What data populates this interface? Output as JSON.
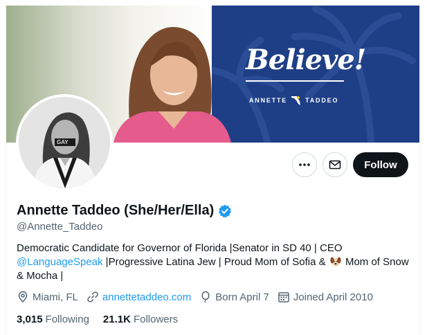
{
  "banner": {
    "slogan": "Believe!",
    "brand_name_part1": "ANNETTE",
    "brand_name_part2": "TADDEO",
    "colors": {
      "banner_blue": "#1e3f86",
      "jacket_pink": "#e55b8c"
    }
  },
  "avatar": {
    "mask_text": "GAY"
  },
  "actions": {
    "more_icon": "more-horizontal-icon",
    "message_icon": "envelope-icon",
    "follow_label": "Follow"
  },
  "profile": {
    "name": "Annette Taddeo (She/Her/Ella)",
    "verified_icon": "verified-badge-icon",
    "handle": "@Annette_Taddeo",
    "bio_part1": "Democratic Candidate for Governor of Florida |Senator in SD 40 | CEO",
    "bio_mention": "@LanguageSpeak",
    "bio_part2": " |Progressive Latina Jew | Proud Mom of Sofia & ",
    "bio_part3": " Mom of Snow & Mocha |",
    "bio_emoji": "dog-face-emoji"
  },
  "meta": {
    "location": "Miami, FL",
    "website": "annettetaddeo.com",
    "birthday": "Born April 7",
    "joined": "Joined April 2010"
  },
  "counts": {
    "following_value": "3,015",
    "following_label": "Following",
    "followers_value": "21.1K",
    "followers_label": "Followers"
  },
  "colors": {
    "link": "#1d9bf0",
    "secondary_text": "#536471",
    "primary_text": "#0f1419"
  }
}
